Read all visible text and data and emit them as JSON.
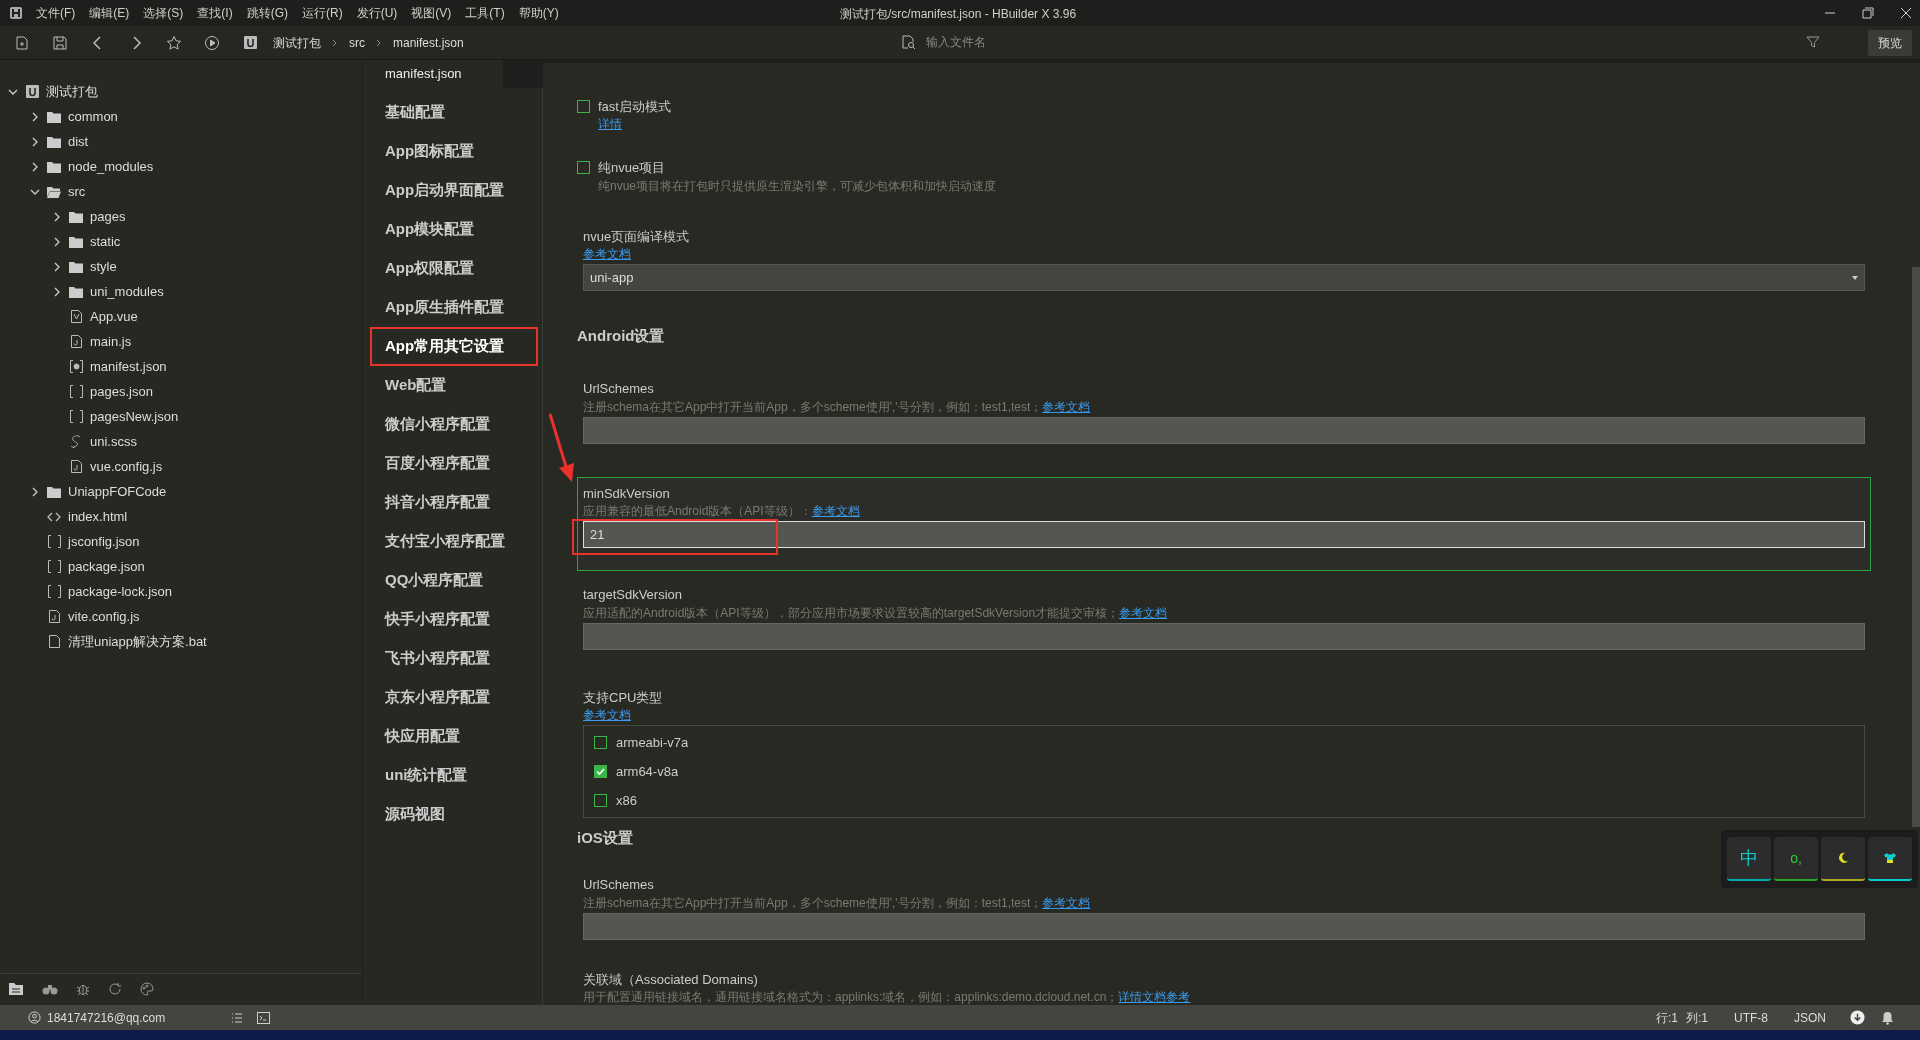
{
  "menu": [
    "文件(F)",
    "编辑(E)",
    "选择(S)",
    "查找(I)",
    "跳转(G)",
    "运行(R)",
    "发行(U)",
    "视图(V)",
    "工具(T)",
    "帮助(Y)"
  ],
  "title": "测试打包/src/manifest.json - HBuilder X 3.96",
  "breadcrumb": [
    "测试打包",
    "src",
    "manifest.json"
  ],
  "file_search": {
    "placeholder": "输入文件名"
  },
  "preview_button": "预览",
  "tree": [
    {
      "label": "测试打包",
      "kind": "project",
      "expanded": true,
      "children": [
        {
          "label": "common",
          "kind": "folder",
          "expanded": false
        },
        {
          "label": "dist",
          "kind": "folder",
          "expanded": false
        },
        {
          "label": "node_modules",
          "kind": "folder",
          "expanded": false
        },
        {
          "label": "src",
          "kind": "folder",
          "expanded": true,
          "children": [
            {
              "label": "pages",
              "kind": "folder",
              "expanded": false
            },
            {
              "label": "static",
              "kind": "folder",
              "expanded": false
            },
            {
              "label": "style",
              "kind": "folder",
              "expanded": false
            },
            {
              "label": "uni_modules",
              "kind": "folder",
              "expanded": false
            },
            {
              "label": "App.vue",
              "kind": "vue"
            },
            {
              "label": "main.js",
              "kind": "js"
            },
            {
              "label": "manifest.json",
              "kind": "manifest"
            },
            {
              "label": "pages.json",
              "kind": "json"
            },
            {
              "label": "pagesNew.json",
              "kind": "json"
            },
            {
              "label": "uni.scss",
              "kind": "scss"
            },
            {
              "label": "vue.config.js",
              "kind": "js"
            }
          ]
        },
        {
          "label": "UniappFOFCode",
          "kind": "folder",
          "expanded": false
        },
        {
          "label": "index.html",
          "kind": "html"
        },
        {
          "label": "jsconfig.json",
          "kind": "json"
        },
        {
          "label": "package.json",
          "kind": "json"
        },
        {
          "label": "package-lock.json",
          "kind": "json"
        },
        {
          "label": "vite.config.js",
          "kind": "js"
        },
        {
          "label": "清理uniapp解决方案.bat",
          "kind": "file"
        }
      ]
    }
  ],
  "editor_tab": "manifest.json",
  "nav": [
    {
      "label": "基础配置",
      "selected": false
    },
    {
      "label": "App图标配置",
      "selected": false
    },
    {
      "label": "App启动界面配置",
      "selected": false
    },
    {
      "label": "App模块配置",
      "selected": false
    },
    {
      "label": "App权限配置",
      "selected": false
    },
    {
      "label": "App原生插件配置",
      "selected": false
    },
    {
      "label": "App常用其它设置",
      "selected": true
    },
    {
      "label": "Web配置",
      "selected": false
    },
    {
      "label": "微信小程序配置",
      "selected": false
    },
    {
      "label": "百度小程序配置",
      "selected": false
    },
    {
      "label": "抖音小程序配置",
      "selected": false
    },
    {
      "label": "支付宝小程序配置",
      "selected": false
    },
    {
      "label": "QQ小程序配置",
      "selected": false
    },
    {
      "label": "快手小程序配置",
      "selected": false
    },
    {
      "label": "飞书小程序配置",
      "selected": false
    },
    {
      "label": "京东小程序配置",
      "selected": false
    },
    {
      "label": "快应用配置",
      "selected": false
    },
    {
      "label": "uni统计配置",
      "selected": false
    },
    {
      "label": "源码视图",
      "selected": false
    }
  ],
  "settings": [
    {
      "kind": "checkbox",
      "label": "fast启动模式",
      "checked": false,
      "link": "详情"
    },
    {
      "kind": "checkbox",
      "label": "纯nvue项目",
      "checked": false,
      "description": "纯nvue项目将在打包时只提供原生渲染引擎，可减少包体积和加快启动速度"
    },
    {
      "kind": "select",
      "label": "nvue页面编译模式",
      "link": "参考文档",
      "value": "uni-app"
    },
    {
      "kind": "heading",
      "label": "Android设置"
    },
    {
      "kind": "text",
      "label": "UrlSchemes",
      "description": "注册schema在其它App中打开当前App，多个scheme使用','号分割，例如：test1,test；",
      "link": "参考文档",
      "focused": false
    },
    {
      "kind": "text",
      "label": "minSdkVersion",
      "description": "应用兼容的最低Android版本（API等级）：",
      "link": "参考文档",
      "value": "21",
      "focused": true
    },
    {
      "kind": "text",
      "label": "targetSdkVersion",
      "description": "应用适配的Android版本（API等级），部分应用市场要求设置较高的targetSdkVersion才能提交审核；",
      "link": "参考文档",
      "focused": false
    },
    {
      "kind": "checklist",
      "label": "支持CPU类型",
      "link": "参考文档",
      "options": [
        {
          "label": "armeabi-v7a",
          "checked": false
        },
        {
          "label": "arm64-v8a",
          "checked": true
        },
        {
          "label": "x86",
          "checked": false
        }
      ]
    },
    {
      "kind": "heading",
      "label": "iOS设置"
    },
    {
      "kind": "text",
      "label": "UrlSchemes",
      "description": "注册schema在其它App中打开当前App，多个scheme使用','号分割，例如：test1,test；",
      "link": "参考文档",
      "focused": false
    },
    {
      "kind": "text",
      "label": "关联域（Associated Domains)",
      "description": "用于配置通用链接域名，通用链接域名格式为：applinks:域名，例如：applinks:demo.dcloud.net.cn；",
      "link": "详情文档参考"
    }
  ],
  "ime": {
    "mode": "中",
    "punctuation": "o,"
  },
  "status_bar": {
    "account": "1841747216@qq.com",
    "row": "行:1",
    "column": "列:1",
    "encoding": "UTF-8",
    "language": "JSON"
  }
}
